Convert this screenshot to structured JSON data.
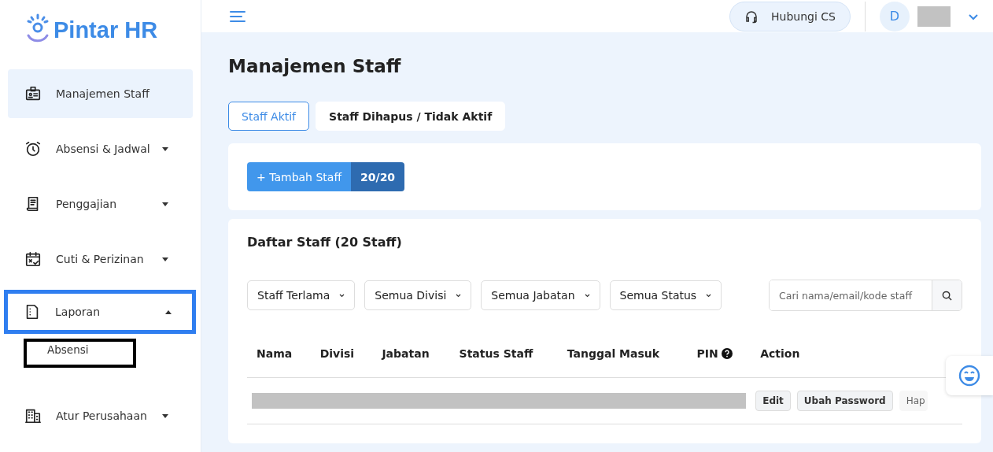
{
  "logo": {
    "text": "Pintar HR"
  },
  "header": {
    "support_button": "Hubungi CS",
    "avatar_initial": "D",
    "user_name_redacted": true
  },
  "sidebar": {
    "items": [
      {
        "label": "Manajemen Staff",
        "selected": true,
        "highlighted": false
      },
      {
        "label": "Absensi & Jadwal",
        "selected": false,
        "expanded": false,
        "highlighted": false
      },
      {
        "label": "Penggajian",
        "selected": false,
        "expanded": false,
        "highlighted": false
      },
      {
        "label": "Cuti & Perizinan",
        "selected": false,
        "expanded": false,
        "highlighted": false
      },
      {
        "label": "Laporan",
        "selected": false,
        "expanded": true,
        "highlighted": true,
        "children": [
          {
            "label": "Absensi",
            "outlined": true
          }
        ]
      },
      {
        "label": "Atur Perusahaan",
        "selected": false,
        "expanded": false,
        "highlighted": false
      }
    ]
  },
  "page": {
    "title": "Manajemen Staff",
    "tabs": [
      {
        "label": "Staff Aktif",
        "selected": true
      },
      {
        "label": "Staff Dihapus / Tidak Aktif",
        "selected": false
      }
    ],
    "add_button": "+ Tambah Staff",
    "quota": "20/20",
    "list_title": "Daftar Staff (20 Staff)",
    "filters": [
      "Staff Terlama",
      "Semua Divisi",
      "Semua Jabatan",
      "Semua Status"
    ],
    "search": {
      "placeholder": "Cari nama/email/kode staff"
    },
    "table": {
      "columns": [
        "Nama",
        "Divisi",
        "Jabatan",
        "Status Staff",
        "Tanggal Masuk",
        "PIN",
        "Action"
      ],
      "rows": [
        {
          "redacted": true,
          "actions": [
            "Edit",
            "Ubah Password",
            "Hap"
          ]
        }
      ]
    }
  }
}
